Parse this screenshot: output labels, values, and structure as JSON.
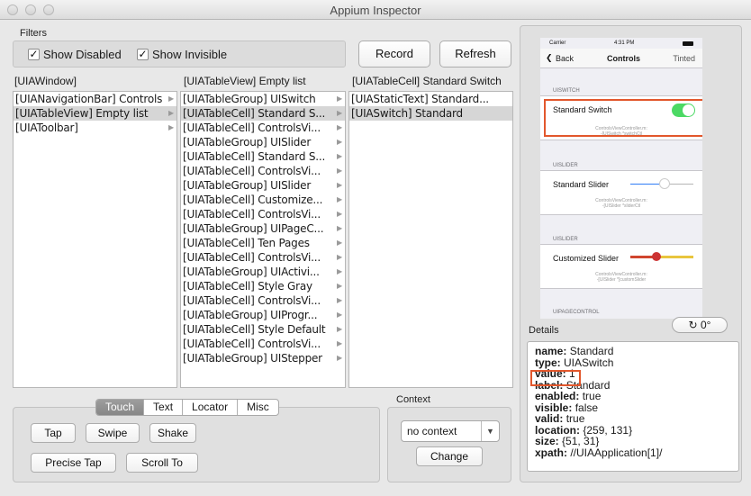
{
  "window": {
    "title": "Appium Inspector"
  },
  "filters": {
    "label": "Filters",
    "show_disabled": {
      "label": "Show Disabled",
      "checked": true
    },
    "show_invisible": {
      "label": "Show Invisible",
      "checked": true
    }
  },
  "toolbar": {
    "record_label": "Record",
    "refresh_label": "Refresh"
  },
  "columns": [
    {
      "header": "[UIAWindow]",
      "items": [
        {
          "label": "[UIANavigationBar] Controls",
          "has_children": true,
          "selected": false
        },
        {
          "label": "[UIATableView] Empty list",
          "has_children": true,
          "selected": true
        },
        {
          "label": "[UIAToolbar]",
          "has_children": true,
          "selected": false
        }
      ]
    },
    {
      "header": "[UIATableView] Empty list",
      "items": [
        {
          "label": "[UIATableGroup] UISwitch",
          "has_children": true,
          "selected": false
        },
        {
          "label": "[UIATableCell] Standard S...",
          "has_children": true,
          "selected": true
        },
        {
          "label": "[UIATableCell] ControlsVi...",
          "has_children": true,
          "selected": false
        },
        {
          "label": "[UIATableGroup] UISlider",
          "has_children": true,
          "selected": false
        },
        {
          "label": "[UIATableCell] Standard S...",
          "has_children": true,
          "selected": false
        },
        {
          "label": "[UIATableCell] ControlsVi...",
          "has_children": true,
          "selected": false
        },
        {
          "label": "[UIATableGroup] UISlider",
          "has_children": true,
          "selected": false
        },
        {
          "label": "[UIATableCell] Customize...",
          "has_children": true,
          "selected": false
        },
        {
          "label": "[UIATableCell] ControlsVi...",
          "has_children": true,
          "selected": false
        },
        {
          "label": "[UIATableGroup] UIPageC...",
          "has_children": true,
          "selected": false
        },
        {
          "label": "[UIATableCell] Ten Pages",
          "has_children": true,
          "selected": false
        },
        {
          "label": "[UIATableCell] ControlsVi...",
          "has_children": true,
          "selected": false
        },
        {
          "label": "[UIATableGroup] UIActivi...",
          "has_children": true,
          "selected": false
        },
        {
          "label": "[UIATableCell] Style Gray",
          "has_children": true,
          "selected": false
        },
        {
          "label": "[UIATableCell] ControlsVi...",
          "has_children": true,
          "selected": false
        },
        {
          "label": "[UIATableGroup] UIProgr...",
          "has_children": true,
          "selected": false
        },
        {
          "label": "[UIATableCell] Style Default",
          "has_children": true,
          "selected": false
        },
        {
          "label": "[UIATableCell] ControlsVi...",
          "has_children": true,
          "selected": false
        },
        {
          "label": "[UIATableGroup] UIStepper",
          "has_children": true,
          "selected": false
        }
      ]
    },
    {
      "header": "[UIATableCell] Standard Switch",
      "items": [
        {
          "label": "[UIAStaticText] Standard...",
          "has_children": false,
          "selected": false
        },
        {
          "label": "[UIASwitch] Standard",
          "has_children": false,
          "selected": true
        }
      ]
    }
  ],
  "action_tabs": {
    "items": [
      "Touch",
      "Text",
      "Locator",
      "Misc"
    ],
    "active": "Touch"
  },
  "touch_actions": {
    "tap": "Tap",
    "swipe": "Swipe",
    "shake": "Shake",
    "precise_tap": "Precise Tap",
    "scroll_to": "Scroll To"
  },
  "context": {
    "label": "Context",
    "selected": "no context",
    "change_label": "Change"
  },
  "phone": {
    "carrier": "Carrier",
    "time": "4:31 PM",
    "back": "Back",
    "title": "Controls",
    "right_item": "Tinted",
    "sections": [
      {
        "header": "UISWITCH",
        "cell": "Standard Switch",
        "sub1": "ControlsViewController.m:",
        "sub2": "-[UISwitch *switchCtl"
      },
      {
        "header": "UISLIDER",
        "cell": "Standard Slider",
        "sub1": "ControlsViewController.m:",
        "sub2": "-[UISlider *sliderCtl"
      },
      {
        "header": "UISLIDER",
        "cell": "Customized Slider",
        "sub1": "ControlsViewController.m:",
        "sub2": "-[UISlider *]customSlider"
      },
      {
        "header": "UIPAGECONTROL"
      }
    ],
    "switch_on_color": "#4cd964",
    "highlight_color": "#e2572c"
  },
  "details": {
    "label": "Details",
    "rotation": "0°",
    "rows": [
      {
        "key": "name:",
        "value": "Standard"
      },
      {
        "key": "type:",
        "value": "UIASwitch"
      },
      {
        "key": "value:",
        "value": "1"
      },
      {
        "key": "label:",
        "value": "Standard"
      },
      {
        "key": "enabled:",
        "value": "true"
      },
      {
        "key": "visible:",
        "value": "false"
      },
      {
        "key": "valid:",
        "value": "true"
      },
      {
        "key": "location:",
        "value": "{259, 131}"
      },
      {
        "key": "size:",
        "value": "{51, 31}"
      },
      {
        "key": "xpath:",
        "value": "//UIAApplication[1]/"
      }
    ]
  }
}
